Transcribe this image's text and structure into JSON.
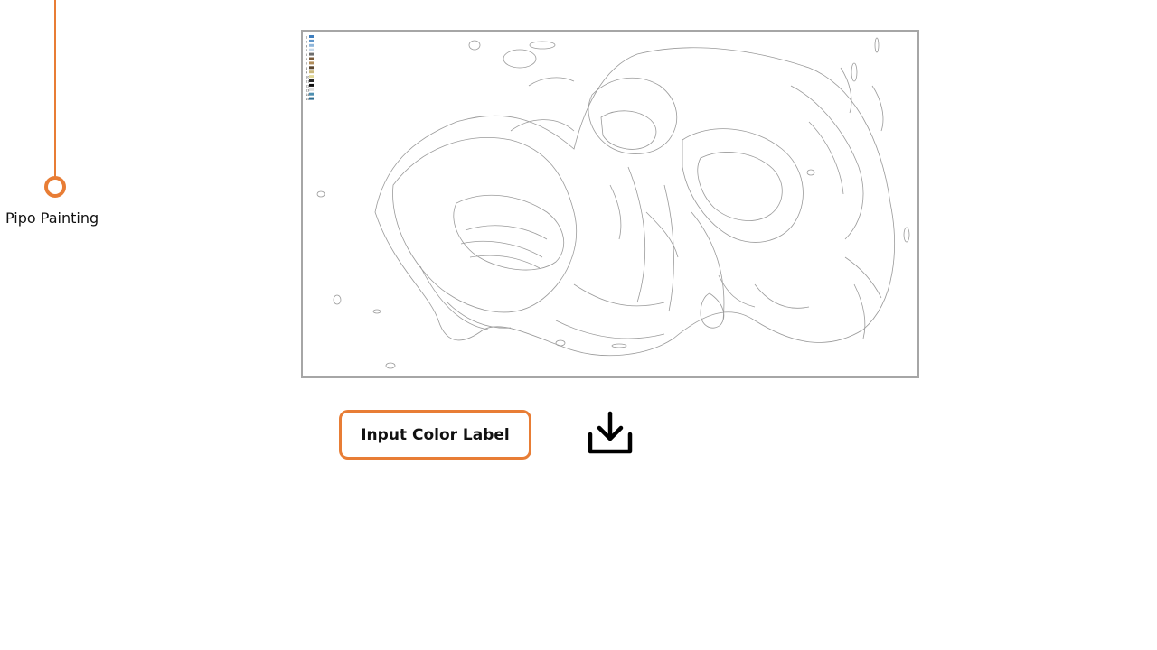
{
  "timeline": {
    "label": "Pipo Painting",
    "accent_color": "#e87d35"
  },
  "preview": {
    "description_icon": "line-art-outline-preview",
    "palette_legend": [
      {
        "number": "1",
        "color": "#3f7fbf"
      },
      {
        "number": "2",
        "color": "#5e95c9"
      },
      {
        "number": "3",
        "color": "#8fb6da"
      },
      {
        "number": "4",
        "color": "#c5d7e8"
      },
      {
        "number": "5",
        "color": "#6e6e6e"
      },
      {
        "number": "6",
        "color": "#7a5a3a"
      },
      {
        "number": "7",
        "color": "#b08c5a"
      },
      {
        "number": "8",
        "color": "#5a4630"
      },
      {
        "number": "9",
        "color": "#c9b77a"
      },
      {
        "number": "10",
        "color": "#e2d89b"
      },
      {
        "number": "11",
        "color": "#2b2b2b"
      },
      {
        "number": "12",
        "color": "#111111"
      },
      {
        "number": "13",
        "color": "#dddddd"
      },
      {
        "number": "14",
        "color": "#4e8fb0"
      },
      {
        "number": "15",
        "color": "#2d6b8f"
      }
    ]
  },
  "actions": {
    "input_color_label": "Input  Color Label",
    "download_icon": "download-icon"
  }
}
